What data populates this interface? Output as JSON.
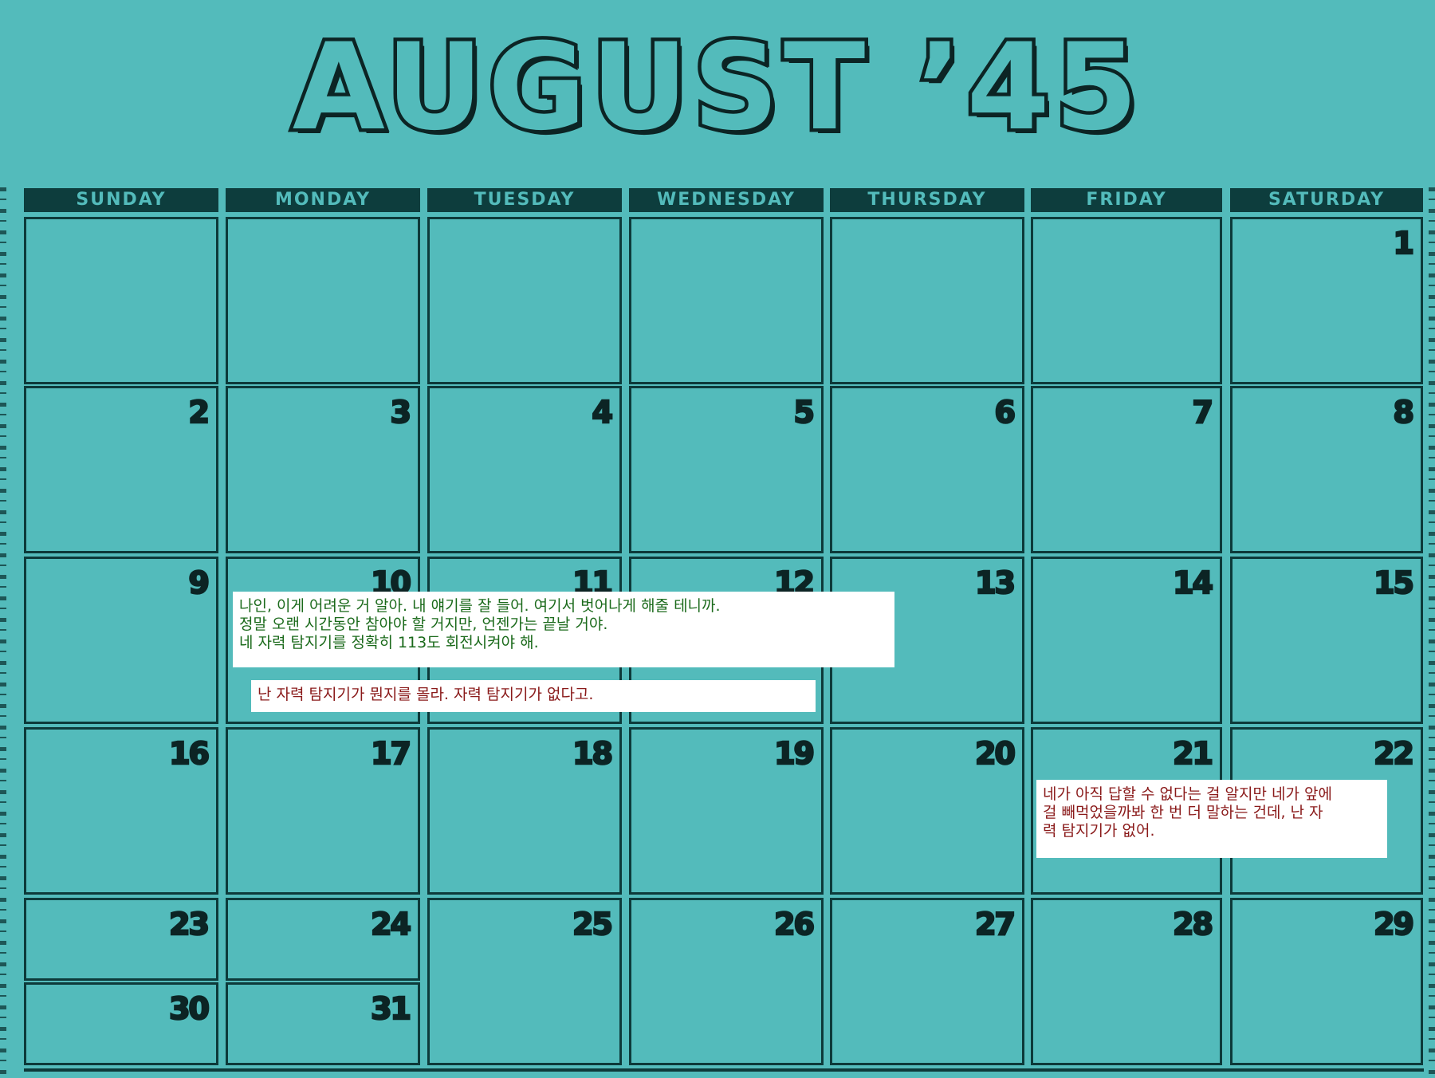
{
  "title": "AUGUST ’45",
  "weekdays": [
    "SUNDAY",
    "MONDAY",
    "TUESDAY",
    "WEDNESDAY",
    "THURSDAY",
    "FRIDAY",
    "SATURDAY"
  ],
  "days": {
    "1": "1",
    "2": "2",
    "3": "3",
    "4": "4",
    "5": "5",
    "6": "6",
    "7": "7",
    "8": "8",
    "9": "9",
    "10": "10",
    "11": "11",
    "12": "12",
    "13": "13",
    "14": "14",
    "15": "15",
    "16": "16",
    "17": "17",
    "18": "18",
    "19": "19",
    "20": "20",
    "21": "21",
    "22": "22",
    "23": "23",
    "24": "24",
    "25": "25",
    "26": "26",
    "27": "27",
    "28": "28",
    "29": "29",
    "30": "30",
    "31": "31"
  },
  "notes": {
    "green": [
      "나인, 이게 어려운 거 알아. 내 얘기를 잘 들어. 여기서 벗어나게 해줄 테니까.",
      "정말 오랜 시간동안 참아야 할 거지만, 언젠가는 끝날 거야.",
      "네 자력 탐지기를 정확히 113도 회전시켜야 해."
    ],
    "red_short": "난 자력 탐지기가 뭔지를 몰라. 자력 탐지기가 없다고.",
    "red_long": [
      "네가 아직 답할 수 없다는 걸 알지만 네가 앞에",
      "걸 빼먹었을까봐 한 번 더 말하는 건데, 난 자",
      "력 탐지기가 없어."
    ]
  },
  "colors": {
    "background": "#53bbbb",
    "ink": "#0c2424",
    "header_bar": "#0d3d3d",
    "note_green_text": "#1b6a1b",
    "note_red_text": "#8a1a1a"
  }
}
